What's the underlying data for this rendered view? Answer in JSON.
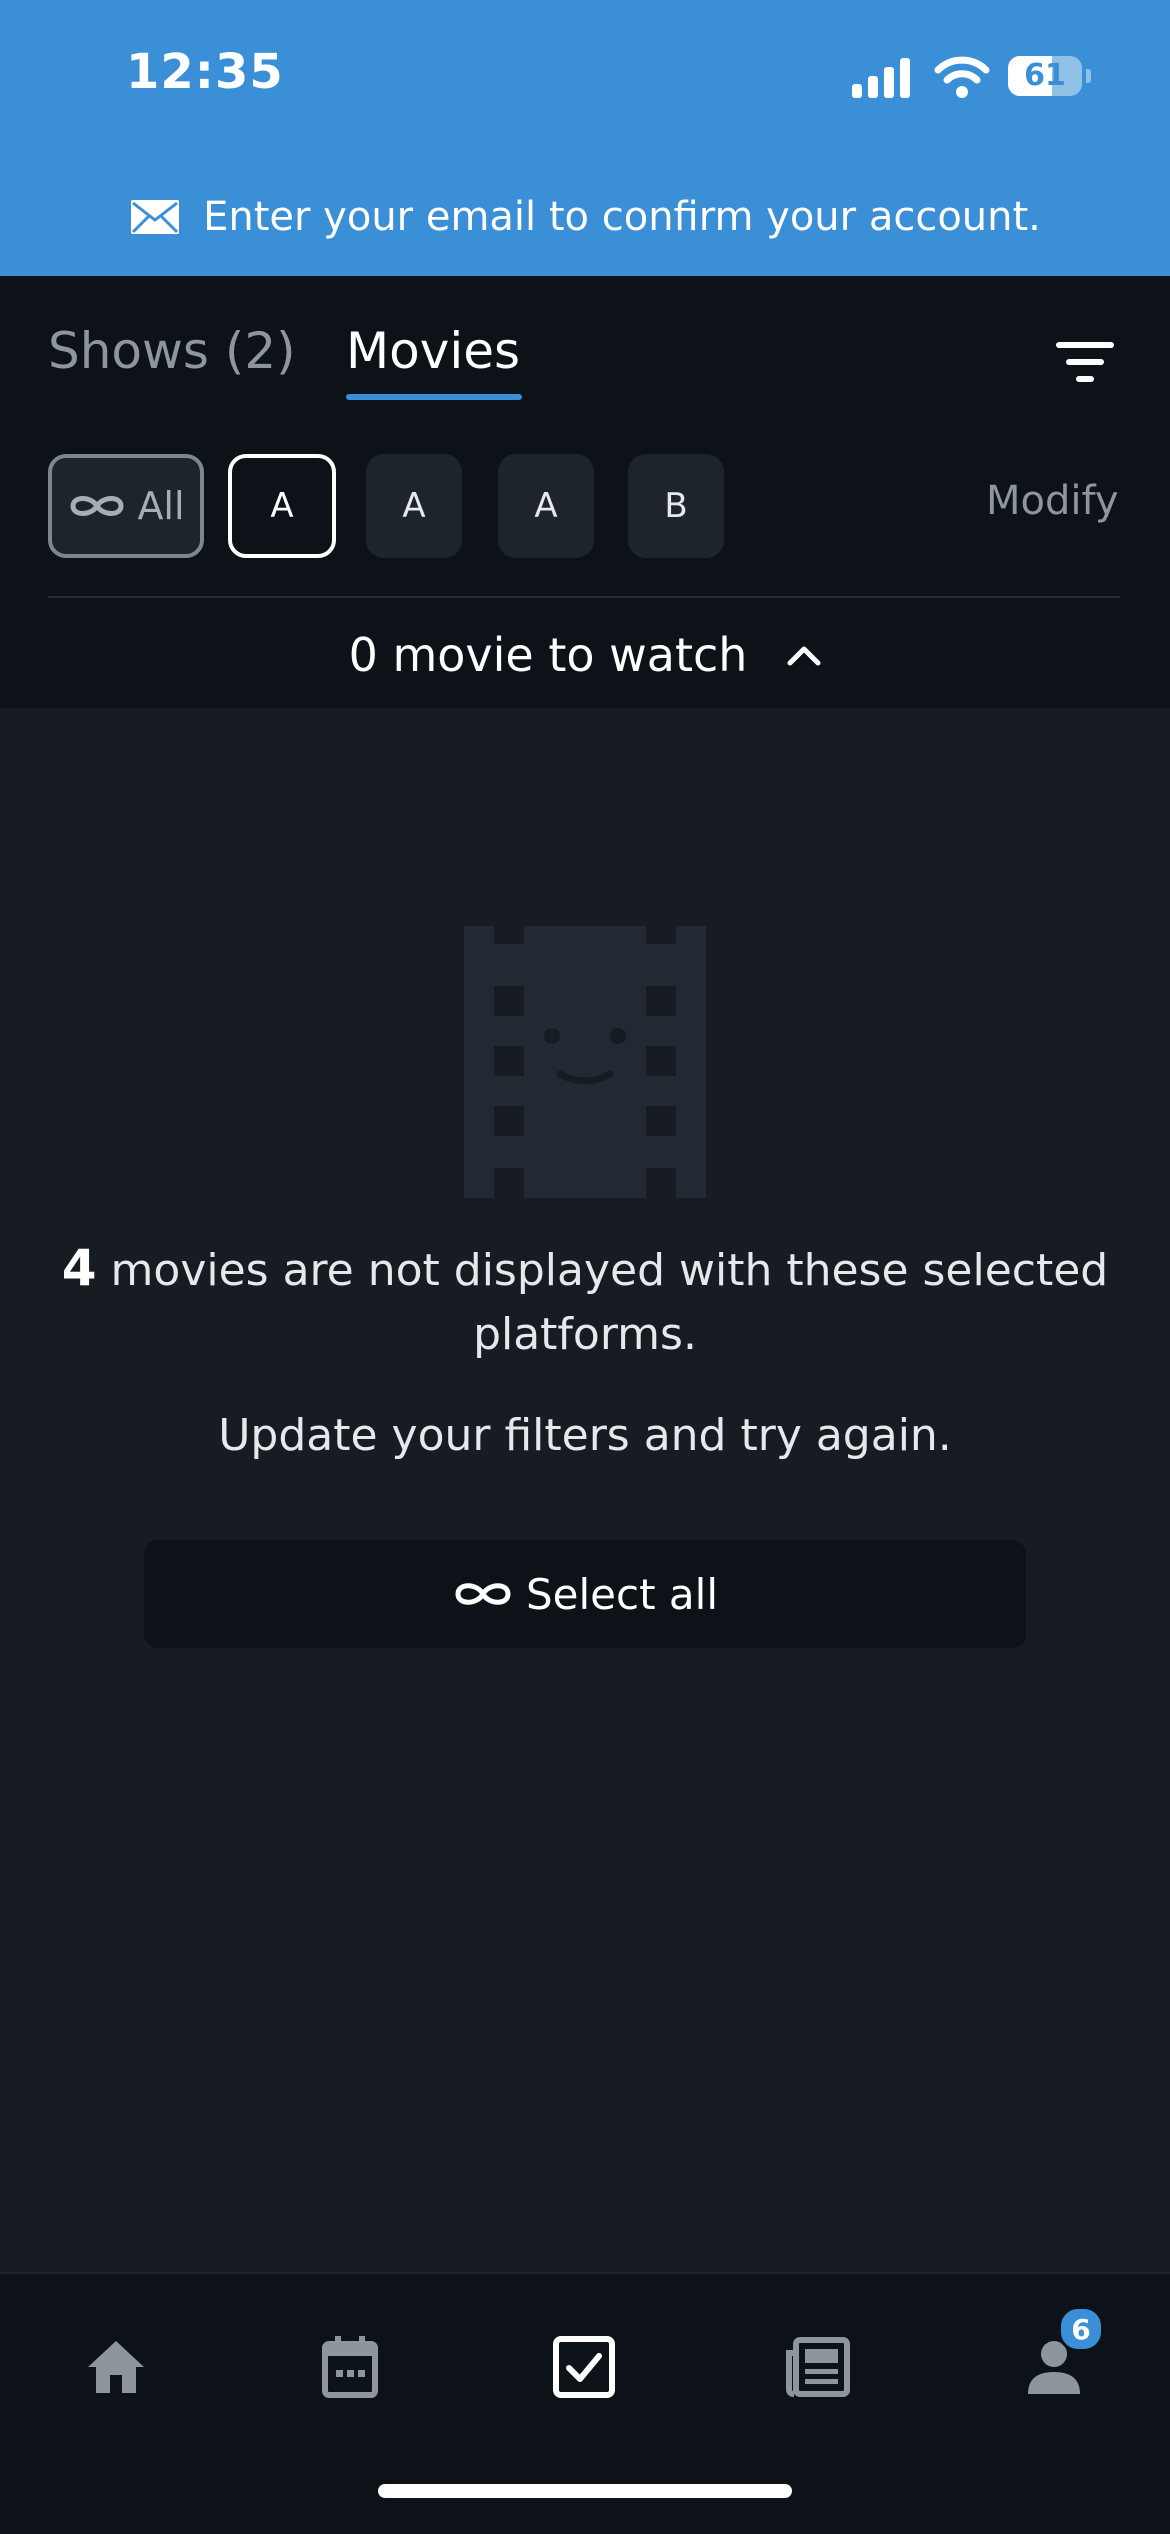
{
  "status_bar": {
    "time": "12:35",
    "battery": "61"
  },
  "banner": {
    "text": "Enter your email to confirm your account."
  },
  "tabs": [
    {
      "label": "Shows (2)",
      "active": false
    },
    {
      "label": "Movies",
      "active": true
    }
  ],
  "platform_chips": [
    {
      "label": "All",
      "icon": "infinity-icon"
    },
    {
      "label": "A",
      "selected": true
    },
    {
      "label": "A"
    },
    {
      "label": "A"
    },
    {
      "label": "B"
    }
  ],
  "modify_label": "Modify",
  "watch_summary": "0 movie to watch",
  "empty_state": {
    "count": "4",
    "message": "movies are not displayed with these selected platforms.",
    "hint": "Update your filters and try again.",
    "button_label": "Select all"
  },
  "nav": {
    "items": [
      "home-icon",
      "calendar-icon",
      "checkbox-icon",
      "news-icon",
      "profile-icon"
    ],
    "profile_badge": "6"
  },
  "colors": {
    "accent": "#3a8fd6",
    "background": "#171c23",
    "header": "#0d1218"
  }
}
